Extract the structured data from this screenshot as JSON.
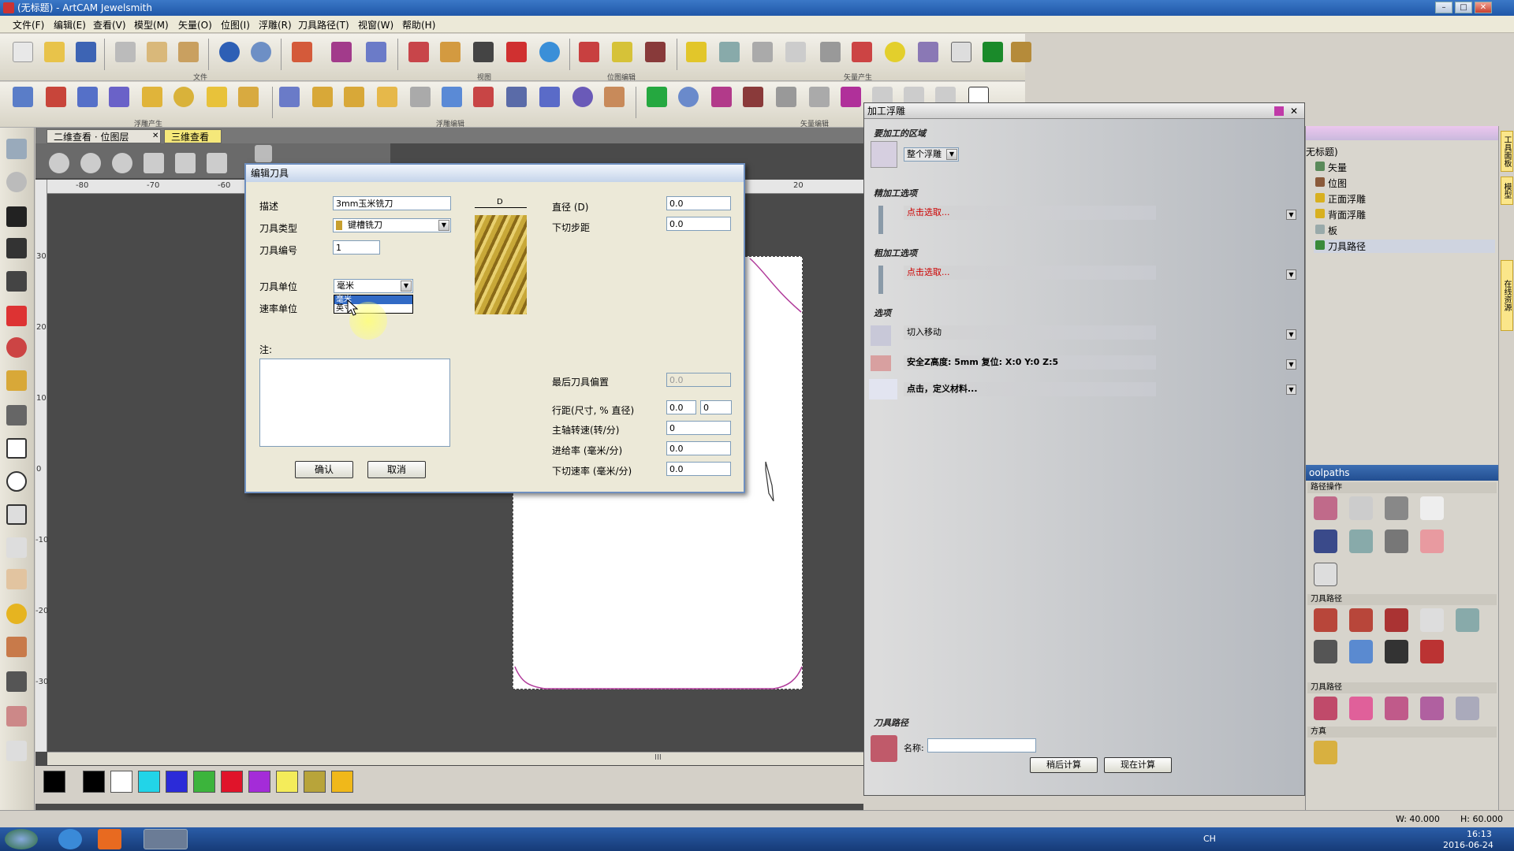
{
  "window": {
    "title": "(无标题) - ArtCAM Jewelsmith",
    "min": "–",
    "max": "□",
    "close": "✕"
  },
  "menus": [
    "文件(F)",
    "编辑(E)",
    "查看(V)",
    "模型(M)",
    "矢量(O)",
    "位图(I)",
    "浮雕(R)",
    "刀具路径(T)",
    "视窗(W)",
    "帮助(H)"
  ],
  "toolbar_groups": {
    "file": "文件",
    "view": "视图",
    "bitmap": "位图编辑",
    "vector_create": "矢量产生",
    "relief_create": "浮雕产生",
    "relief_edit": "浮雕编辑",
    "vector_edit": "矢量编辑"
  },
  "tabs": {
    "view2d": "二维查看 · 位图层",
    "view2d_close": "✕",
    "view3d": "三维查看"
  },
  "ruler_h": [
    "-80",
    "-70",
    "-60",
    "20"
  ],
  "ruler_v": [
    "30",
    "20",
    "10",
    "0",
    "-10",
    "-20",
    "-30"
  ],
  "scroll_mark": "III",
  "colors": {
    "accent": "#316ac5",
    "red_text": "#cc0000",
    "highlight": "#ffff66"
  },
  "dialog": {
    "title": "编辑刀具",
    "desc_label": "描述",
    "desc_value": "3mm玉米铣刀",
    "type_label": "刀具类型",
    "type_value": "键槽铣刀",
    "number_label": "刀具编号",
    "number_value": "1",
    "unit_label": "刀具单位",
    "unit_value": "毫米",
    "rate_unit_label": "速率单位",
    "unit_options": [
      "毫米",
      "英寸"
    ],
    "notes_label": "注:",
    "tool_dim_label": "D",
    "diameter_label": "直径 (D)",
    "diameter_value": "0.0",
    "stepdown_label": "下切步距",
    "stepdown_value": "0.0",
    "finish_offset_label": "最后刀具偏置",
    "finish_offset_value": "0.0",
    "stepover_label": "行距(尺寸, % 直径)",
    "stepover_value": "0.0",
    "stepover_pct": "0",
    "spindle_label": "主轴转速(转/分)",
    "spindle_value": "0",
    "feed_label": "进给率 (毫米/分)",
    "feed_value": "0.0",
    "plunge_label": "下切速率 (毫米/分)",
    "plunge_value": "0.0",
    "ok": "确认",
    "cancel": "取消"
  },
  "machpanel": {
    "title": "加工浮雕",
    "area_label": "要加工的区域",
    "area_value": "整个浮雕",
    "finish_label": "精加工选项",
    "finish_value": "点击选取...",
    "rough_label": "粗加工选项",
    "rough_value": "点击选取...",
    "options_label": "选项",
    "lead_in": "切入移动",
    "safe_z": "安全Z高度: 5mm 复位: X:0 Y:0 Z:5",
    "material": "点击，定义材料...",
    "toolpath_label": "刀具路径",
    "name_label": "名称:",
    "name_value": "",
    "calc_later": "稍后计算",
    "calc_now": "现在计算"
  },
  "tree": {
    "root": "无标题)",
    "items": [
      "矢量",
      "位图",
      "正面浮雕",
      "背面浮雕",
      "板",
      "刀具路径"
    ]
  },
  "toolpaths_panel": {
    "title": "oolpaths",
    "sections": [
      "路径操作",
      "刀具路径",
      "刀具路径",
      "方真"
    ]
  },
  "edge_tabs": [
    "工具面板",
    "模型",
    "在线资源"
  ],
  "status": {
    "w": "W: 40.000",
    "h": "H: 60.000"
  },
  "tray": {
    "lang": "CH",
    "time": "16:13",
    "date": "2016-06-24"
  }
}
